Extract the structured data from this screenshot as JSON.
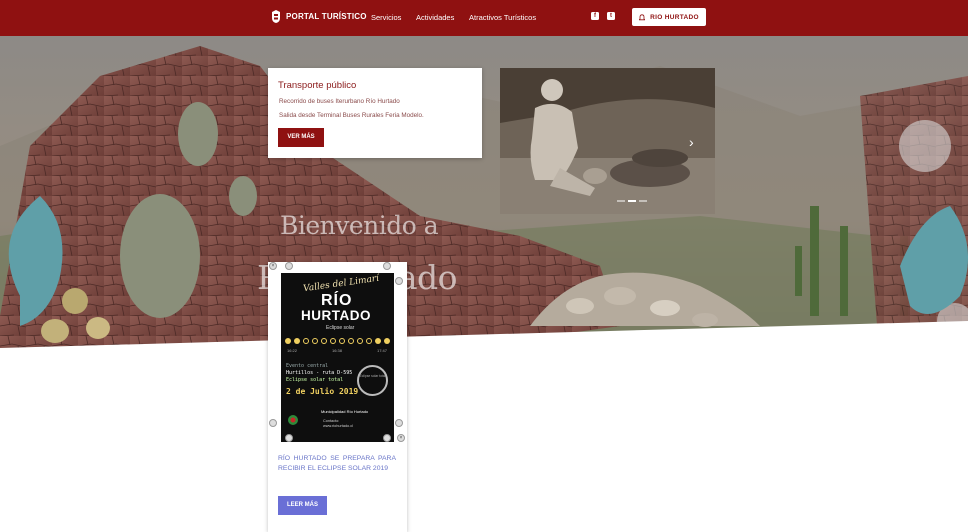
{
  "navbar": {
    "brand": "PORTAL TURÍSTICO",
    "links": [
      "Servicios",
      "Actividades",
      "Atractivos Turísticos"
    ],
    "social": [
      "facebook-icon",
      "twitter-icon"
    ],
    "cta_label": "RIO HURTADO"
  },
  "hero": {
    "welcome_line1": "Bienvenido a",
    "welcome_line2": "Río Hurtado"
  },
  "transport_card": {
    "title": "Transporte público",
    "line1": "Recorrido de buses Iterurbano Río Hurtado",
    "line2": "Salida desde Terminal Buses Rurales Feria Modelo.",
    "button": "VER MÁS"
  },
  "slider": {
    "next_arrow": "›",
    "slide_count": 3,
    "active_slide": 2
  },
  "news_card": {
    "poster": {
      "line1": "Valles del Limarí",
      "line2": "RÍO",
      "line3": "HURTADO",
      "line4": "Eclipse solar",
      "dates": [
        "16:22",
        "16:38",
        "17:47"
      ],
      "event1": "Evento central",
      "event2": "Hurtillos - ruta D-595",
      "event3": "Eclipse solar total",
      "event_date": "2 de Julio 2019",
      "ring": "Eclipse solar total",
      "muni": "Municipalidad Río Hurtado",
      "contact1": "Contacto:",
      "contact2": "www.riohurtado.cl"
    },
    "title": "RÍO HURTADO SE PREPARA PARA RECIBIR EL ECLIPSE SOLAR 2019",
    "button": "LEER MÁS"
  },
  "colors": {
    "brand_red": "#8f1111",
    "news_blue": "#6a6fd6",
    "title_red": "#8a1a1a"
  }
}
